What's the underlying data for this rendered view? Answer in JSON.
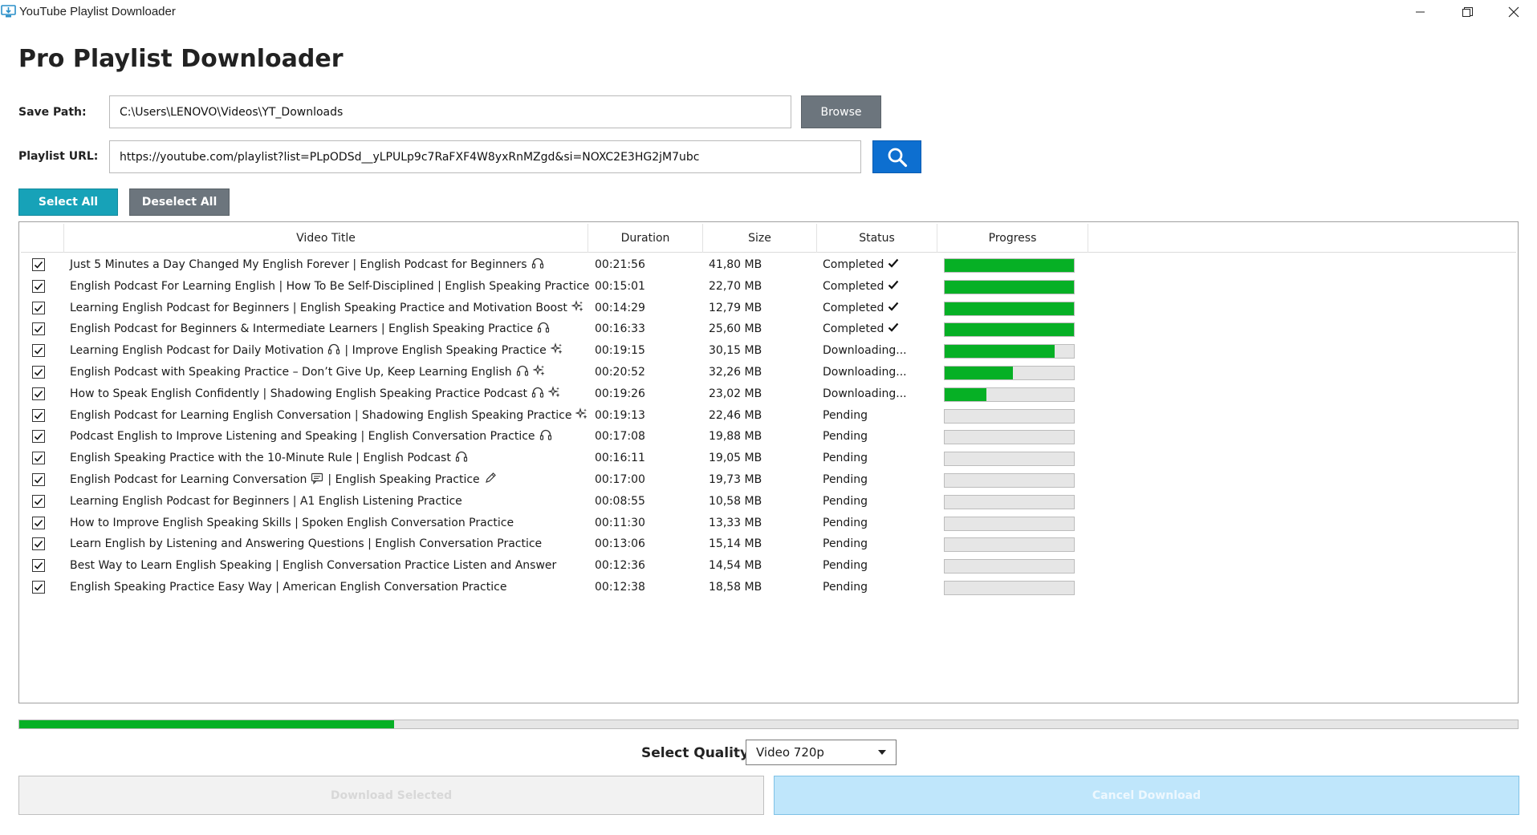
{
  "window": {
    "title": "YouTube Playlist Downloader",
    "icon": "monitor-download-icon"
  },
  "app_title": "Pro Playlist Downloader",
  "save_path": {
    "label": "Save Path:",
    "value": "C:\\Users\\LENOVO\\Videos\\YT_Downloads",
    "browse_label": "Browse"
  },
  "playlist": {
    "label": "Playlist URL:",
    "value": "https://youtube.com/playlist?list=PLpODSd__yLPULp9c7RaFXF4W8yxRnMZgd&si=NOXC2E3HG2jM7ubc",
    "search_icon": "search-icon"
  },
  "selection": {
    "select_all": "Select All",
    "deselect_all": "Deselect All"
  },
  "table": {
    "columns": [
      "Video Title",
      "Duration",
      "Size",
      "Status",
      "Progress"
    ],
    "rows": [
      {
        "checked": true,
        "title": "Just 5 Minutes a Day Changed My English Forever | English Podcast for Beginners",
        "icons": [
          "headphones-icon"
        ],
        "duration": "00:21:56",
        "size": "41,80 MB",
        "status": "Completed",
        "status_check": true,
        "progress": 1.0
      },
      {
        "checked": true,
        "title": "English Podcast For Learning English | How To Be Self-Disciplined | English Speaking Practice",
        "icons": [],
        "duration": "00:15:01",
        "size": "22,70 MB",
        "status": "Completed",
        "status_check": true,
        "progress": 1.0
      },
      {
        "checked": true,
        "title": "Learning English Podcast for Beginners | English Speaking Practice and Motivation Boost",
        "icons": [
          "sparkles-icon"
        ],
        "duration": "00:14:29",
        "size": "12,79 MB",
        "status": "Completed",
        "status_check": true,
        "progress": 1.0
      },
      {
        "checked": true,
        "title": "English Podcast for Beginners & Intermediate Learners | English Speaking Practice",
        "icons": [
          "headphones-icon"
        ],
        "duration": "00:16:33",
        "size": "25,60 MB",
        "status": "Completed",
        "status_check": true,
        "progress": 1.0
      },
      {
        "checked": true,
        "title": "Learning English Podcast for Daily Motivation",
        "icons": [
          "headphones-icon"
        ],
        "title_suffix": "| Improve English Speaking Practice",
        "suffix_icons": [
          "sparkles-icon"
        ],
        "duration": "00:19:15",
        "size": "30,15 MB",
        "status": "Downloading...",
        "status_check": false,
        "progress": 0.85
      },
      {
        "checked": true,
        "title": "English Podcast with Speaking Practice – Don’t Give Up, Keep Learning English",
        "icons": [
          "headphones-icon",
          "sparkles-icon"
        ],
        "duration": "00:20:52",
        "size": "32,26 MB",
        "status": "Downloading...",
        "status_check": false,
        "progress": 0.53
      },
      {
        "checked": true,
        "title": "How to Speak English Confidently | Shadowing English Speaking Practice Podcast",
        "icons": [
          "headphones-icon",
          "sparkles-icon"
        ],
        "duration": "00:19:26",
        "size": "23,02 MB",
        "status": "Downloading...",
        "status_check": false,
        "progress": 0.32
      },
      {
        "checked": true,
        "title": "English Podcast for Learning English Conversation | Shadowing English Speaking Practice",
        "icons": [
          "sparkles-icon"
        ],
        "duration": "00:19:13",
        "size": "22,46 MB",
        "status": "Pending",
        "status_check": false,
        "progress": 0
      },
      {
        "checked": true,
        "title": "Podcast English to Improve Listening and Speaking | English Conversation Practice",
        "icons": [
          "headphones-icon"
        ],
        "duration": "00:17:08",
        "size": "19,88 MB",
        "status": "Pending",
        "status_check": false,
        "progress": 0
      },
      {
        "checked": true,
        "title": "English Speaking Practice with the 10-Minute Rule | English Podcast",
        "icons": [
          "headphones-icon"
        ],
        "duration": "00:16:11",
        "size": "19,05 MB",
        "status": "Pending",
        "status_check": false,
        "progress": 0
      },
      {
        "checked": true,
        "title": "English Podcast for Learning Conversation",
        "icons": [
          "speech-bubble-icon"
        ],
        "title_suffix": "| English Speaking Practice",
        "suffix_icons": [
          "pencil-icon"
        ],
        "duration": "00:17:00",
        "size": "19,73 MB",
        "status": "Pending",
        "status_check": false,
        "progress": 0
      },
      {
        "checked": true,
        "title": "Learning English Podcast for Beginners | A1 English Listening Practice",
        "icons": [],
        "duration": "00:08:55",
        "size": "10,58 MB",
        "status": "Pending",
        "status_check": false,
        "progress": 0
      },
      {
        "checked": true,
        "title": "How to Improve English Speaking Skills | Spoken English Conversation Practice",
        "icons": [],
        "duration": "00:11:30",
        "size": "13,33 MB",
        "status": "Pending",
        "status_check": false,
        "progress": 0
      },
      {
        "checked": true,
        "title": "Learn English by Listening and Answering Questions | English Conversation Practice",
        "icons": [],
        "duration": "00:13:06",
        "size": "15,14 MB",
        "status": "Pending",
        "status_check": false,
        "progress": 0
      },
      {
        "checked": true,
        "title": "Best Way to Learn English Speaking | English Conversation Practice Listen and Answer",
        "icons": [],
        "duration": "00:12:36",
        "size": "14,54 MB",
        "status": "Pending",
        "status_check": false,
        "progress": 0
      },
      {
        "checked": true,
        "title": "English Speaking Practice Easy Way | American English Conversation Practice",
        "icons": [],
        "duration": "00:12:38",
        "size": "18,58 MB",
        "status": "Pending",
        "status_check": false,
        "progress": 0
      }
    ]
  },
  "overall_progress": 0.25,
  "quality": {
    "label": "Select Quality:",
    "value": "Video 720p"
  },
  "actions": {
    "download_selected": "Download Selected",
    "cancel_download": "Cancel Download"
  },
  "colors": {
    "accent_teal": "#17a2b8",
    "secondary_gray": "#6c757d",
    "search_blue": "#0d6fd0",
    "progress_green": "#06b025",
    "cancel_light_blue": "#bfe6fb"
  }
}
